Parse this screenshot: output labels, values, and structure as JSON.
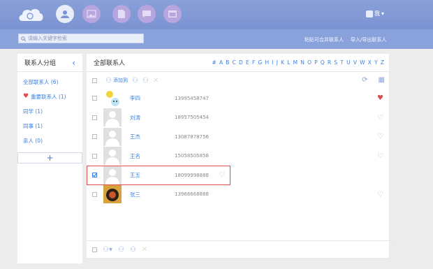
{
  "header": {
    "nav": [
      {
        "icon": "contacts-icon",
        "active": true
      },
      {
        "icon": "image-icon",
        "active": false
      },
      {
        "icon": "document-icon",
        "active": false
      },
      {
        "icon": "message-icon",
        "active": false
      },
      {
        "icon": "calendar-icon",
        "active": false
      }
    ],
    "user_label": "我"
  },
  "subbar": {
    "search_placeholder": "请输入关键字检索",
    "merge_link": "粘贴可合并联系人",
    "import_export_link": "导入/导出联系人"
  },
  "sidebar": {
    "title": "联系人分组",
    "groups": [
      {
        "label": "全部联系人 (6)",
        "icon": ""
      },
      {
        "label": "重要联系人 (1)",
        "icon": "heart-icon"
      },
      {
        "label": "同学 (1)",
        "icon": ""
      },
      {
        "label": "同事 (1)",
        "icon": ""
      },
      {
        "label": "亲人 (0)",
        "icon": ""
      }
    ],
    "add_label": "+"
  },
  "main": {
    "title": "全部联系人",
    "alphabet": [
      "#",
      "A",
      "B",
      "C",
      "D",
      "E",
      "F",
      "G",
      "H",
      "I",
      "J",
      "K",
      "L",
      "M",
      "N",
      "O",
      "P",
      "Q",
      "R",
      "S",
      "T",
      "U",
      "V",
      "W",
      "X",
      "Y",
      "Z"
    ],
    "toolbar": {
      "add_label": "添加到"
    },
    "contacts": [
      {
        "name": "李四",
        "phone": "13995458747",
        "favorite": true,
        "checked": false,
        "avatar": "cartoon"
      },
      {
        "name": "刘涛",
        "phone": "18957505454",
        "favorite": false,
        "checked": false,
        "avatar": "default"
      },
      {
        "name": "王杰",
        "phone": "13087878756",
        "favorite": false,
        "checked": false,
        "avatar": "default"
      },
      {
        "name": "王名",
        "phone": "15058505858",
        "favorite": false,
        "checked": false,
        "avatar": "default"
      },
      {
        "name": "王五",
        "phone": "18099998888",
        "favorite": false,
        "checked": true,
        "avatar": "default"
      },
      {
        "name": "张三",
        "phone": "13966668888",
        "favorite": false,
        "checked": false,
        "avatar": "photo"
      }
    ]
  },
  "colors": {
    "accent": "#3b80e6",
    "header": "#7b93d2",
    "favorite": "#e04a4a",
    "selection": "#e05050"
  }
}
